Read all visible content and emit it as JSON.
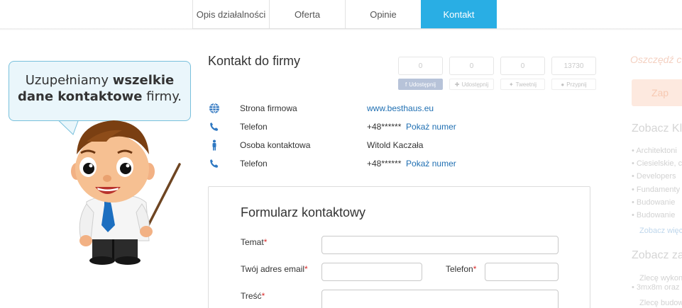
{
  "tabs": [
    "Opis działalności",
    "Oferta",
    "Opinie",
    "Kontakt"
  ],
  "heading": "Kontakt do firmy",
  "counters": [
    "0",
    "0",
    "0",
    "13730"
  ],
  "shares": [
    "Udostępnij",
    "Udostępnij",
    "Tweetnij",
    "Przypnij"
  ],
  "contact": {
    "website_label": "Strona firmowa",
    "website": "www.besthaus.eu",
    "phone_label": "Telefon",
    "phone_masked": "+48******",
    "show_number": "Pokaż numer",
    "person_label": "Osoba kontaktowa",
    "person": "Witold Kaczała",
    "phone2_label": "Telefon",
    "phone2_masked": "+48******",
    "show_number2": "Pokaż numer"
  },
  "form": {
    "title": "Formularz kontaktowy",
    "subject_label": "Temat",
    "email_label": "Twój adres email",
    "phone_label": "Telefon",
    "message_label": "Treść",
    "required_mark": "*"
  },
  "bubble": {
    "part1": "Uzupełniamy ",
    "bold1": "wszelkie",
    "bold2": "dane kontaktowe",
    "part2": " firmy."
  },
  "sidebar": {
    "promo": "Oszczędź c",
    "button": "Zap",
    "heading1": "Zobacz Kl",
    "items": [
      "Architektoni",
      "Ciesielskie, c",
      "Developers",
      "Fundamenty",
      "Budowanie",
      "Budowanie"
    ],
    "more": "Zobacz więc",
    "heading2": "Zobacz za",
    "items2": [
      "Zlecę wykon",
      "3mx8m oraz",
      "Zlecę budow"
    ]
  },
  "colors": {
    "accent": "#29aee4",
    "link": "#1f6fb2",
    "required": "#d92b2b"
  }
}
